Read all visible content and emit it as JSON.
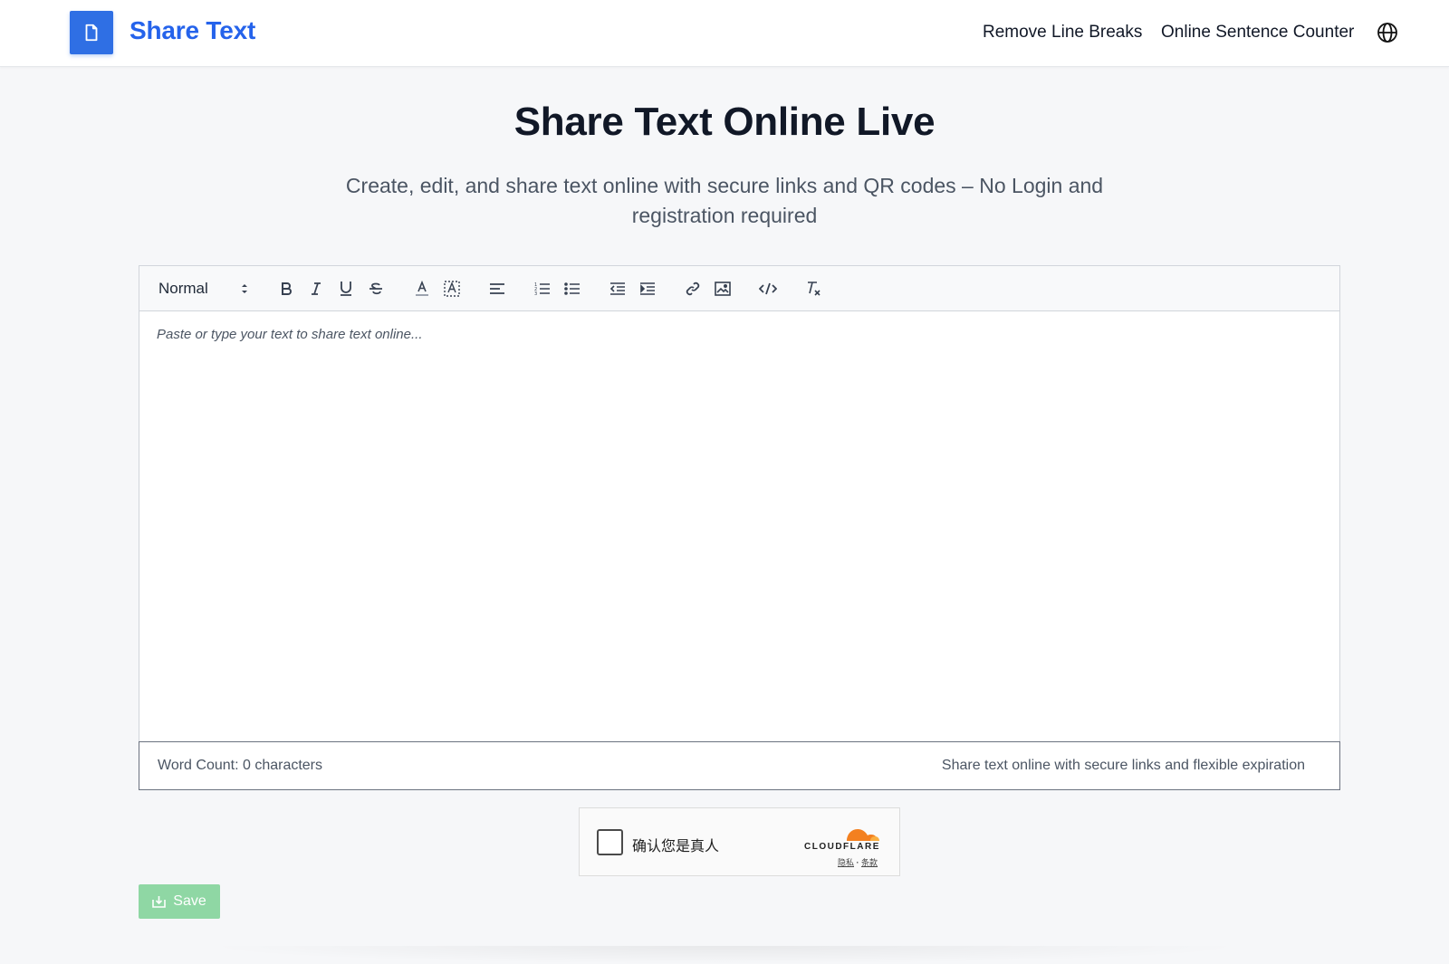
{
  "header": {
    "brand": "Share Text",
    "nav": [
      "Remove Line Breaks",
      "Online Sentence Counter"
    ],
    "language_icon": "globe-icon"
  },
  "hero": {
    "title": "Share Text Online Live",
    "subtitle": "Create, edit, and share text online with secure links and QR codes – No Login and registration required"
  },
  "editor": {
    "header_select": "Normal",
    "toolbar_icons": [
      "bold-icon",
      "italic-icon",
      "underline-icon",
      "strikethrough-icon",
      "text-color-icon",
      "background-color-icon",
      "align-icon",
      "ordered-list-icon",
      "bullet-list-icon",
      "outdent-icon",
      "indent-icon",
      "link-icon",
      "image-icon",
      "code-icon",
      "clear-format-icon"
    ],
    "placeholder": "Paste or type your text to share text online...",
    "word_count": "Word Count: 0 characters",
    "tagline": "Share text online with secure links and flexible expiration"
  },
  "captcha": {
    "label": "确认您是真人",
    "brand": "CLOUDFLARE",
    "privacy": "隐私",
    "separator": "·",
    "terms": "条款"
  },
  "save": {
    "label": "Save"
  },
  "colors": {
    "brand_blue": "#2563eb",
    "logo_bg": "#2f6fe4",
    "save_green": "#8fd7a4",
    "cloudflare_orange": "#f38020"
  }
}
